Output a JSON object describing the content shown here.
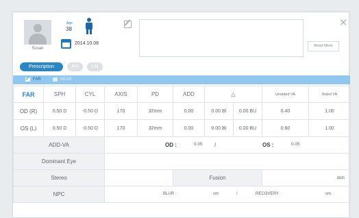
{
  "patient": {
    "name": "Susan",
    "age_label": "Age",
    "age_value": "38",
    "date": "2014.10.08"
  },
  "memo": {
    "read_more_label": "Read More"
  },
  "tabs": [
    {
      "label": "Prescription",
      "active": true
    },
    {
      "label": "PH",
      "active": false
    },
    {
      "label": "LM",
      "active": false
    }
  ],
  "distance": {
    "far_label": "FAR",
    "near_label": "NEAR",
    "far_checked": true,
    "near_checked": false
  },
  "table": {
    "headers": [
      "FAR",
      "SPH",
      "CYL",
      "AXIS",
      "PD",
      "ADD",
      "△",
      "Unaided VA",
      "Aided VA"
    ],
    "rows": [
      {
        "eye": "OD (R)",
        "sph": "0.50 D",
        "cyl": "-0.50 D",
        "axis": "170",
        "pd": "32mm",
        "add": "0.00",
        "prism1": "0.00 BI",
        "prism2": "0.00 BU",
        "unaided": "0.40",
        "aided": "1.00"
      },
      {
        "eye": "OS (L)",
        "sph": "0.50 D",
        "cyl": "-0.50 D",
        "axis": "170",
        "pd": "32mm",
        "add": "0.00",
        "prism1": "0.00 BI",
        "prism2": "0.00 BU",
        "unaided": "0.60",
        "aided": "1.00"
      }
    ],
    "add_va": {
      "label": "ADD-VA",
      "od_label": "OD :",
      "od_value": "0.05",
      "separator": "/",
      "os_label": "OS :",
      "os_value": "0.05"
    },
    "dominant_eye": {
      "label": "Dominant Eye"
    },
    "stereo": {
      "label": "Stereo",
      "fusion_label": "Fusion",
      "unit": "dots"
    },
    "npc": {
      "label": "NPC",
      "blur_label": "BLUR :",
      "blur_unit": "cm",
      "separator": "/",
      "recovery_label": "RECOVERY :",
      "recovery_unit": "cm"
    }
  },
  "colors": {
    "accent": "#2b86c5",
    "bar": "#8fc7ee",
    "person_icon": "#1f66a8"
  }
}
